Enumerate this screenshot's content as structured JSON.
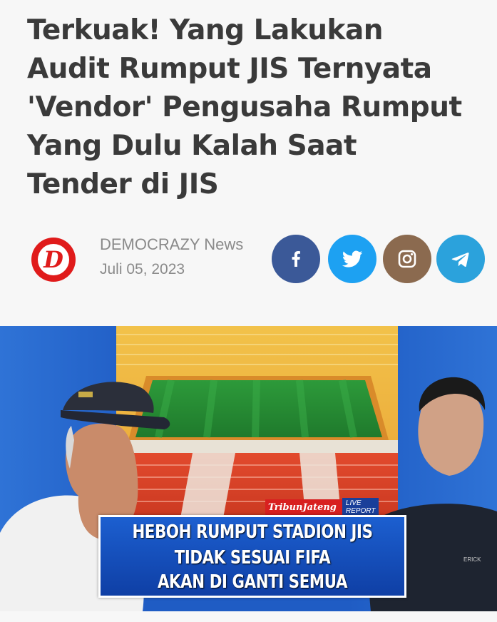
{
  "article": {
    "headline_lines": [
      "Terkuak! Yang Lakukan",
      "Audit Rumput JIS Ternyata",
      "'Vendor' Pengusaha Rumput",
      "Yang Dulu Kalah Saat",
      "Tender di JIS"
    ],
    "source": "DEMOCRAZY News",
    "date": "Juli 05, 2023",
    "logo_glyph": "D"
  },
  "share": {
    "facebook_icon": "facebook-icon",
    "twitter_icon": "twitter-icon",
    "instagram_icon": "instagram-icon",
    "telegram_icon": "telegram-icon",
    "colors": {
      "facebook": "#3b5998",
      "twitter": "#1da1f2",
      "instagram": "#8b6a4f",
      "telegram": "#2ba2dc"
    }
  },
  "image": {
    "tag_brand": "TribunJateng",
    "tag_live": "LIVE REPORT",
    "caption_lines": [
      "HEBOH RUMPUT STADION JIS",
      "TIDAK SESUAI FIFA",
      "AKAN DI GANTI SEMUA"
    ],
    "jacket_label": "ERICK"
  },
  "colors": {
    "headline": "#3a3a3a",
    "meta": "#8a8a8a",
    "logo": "#e01b1b"
  }
}
